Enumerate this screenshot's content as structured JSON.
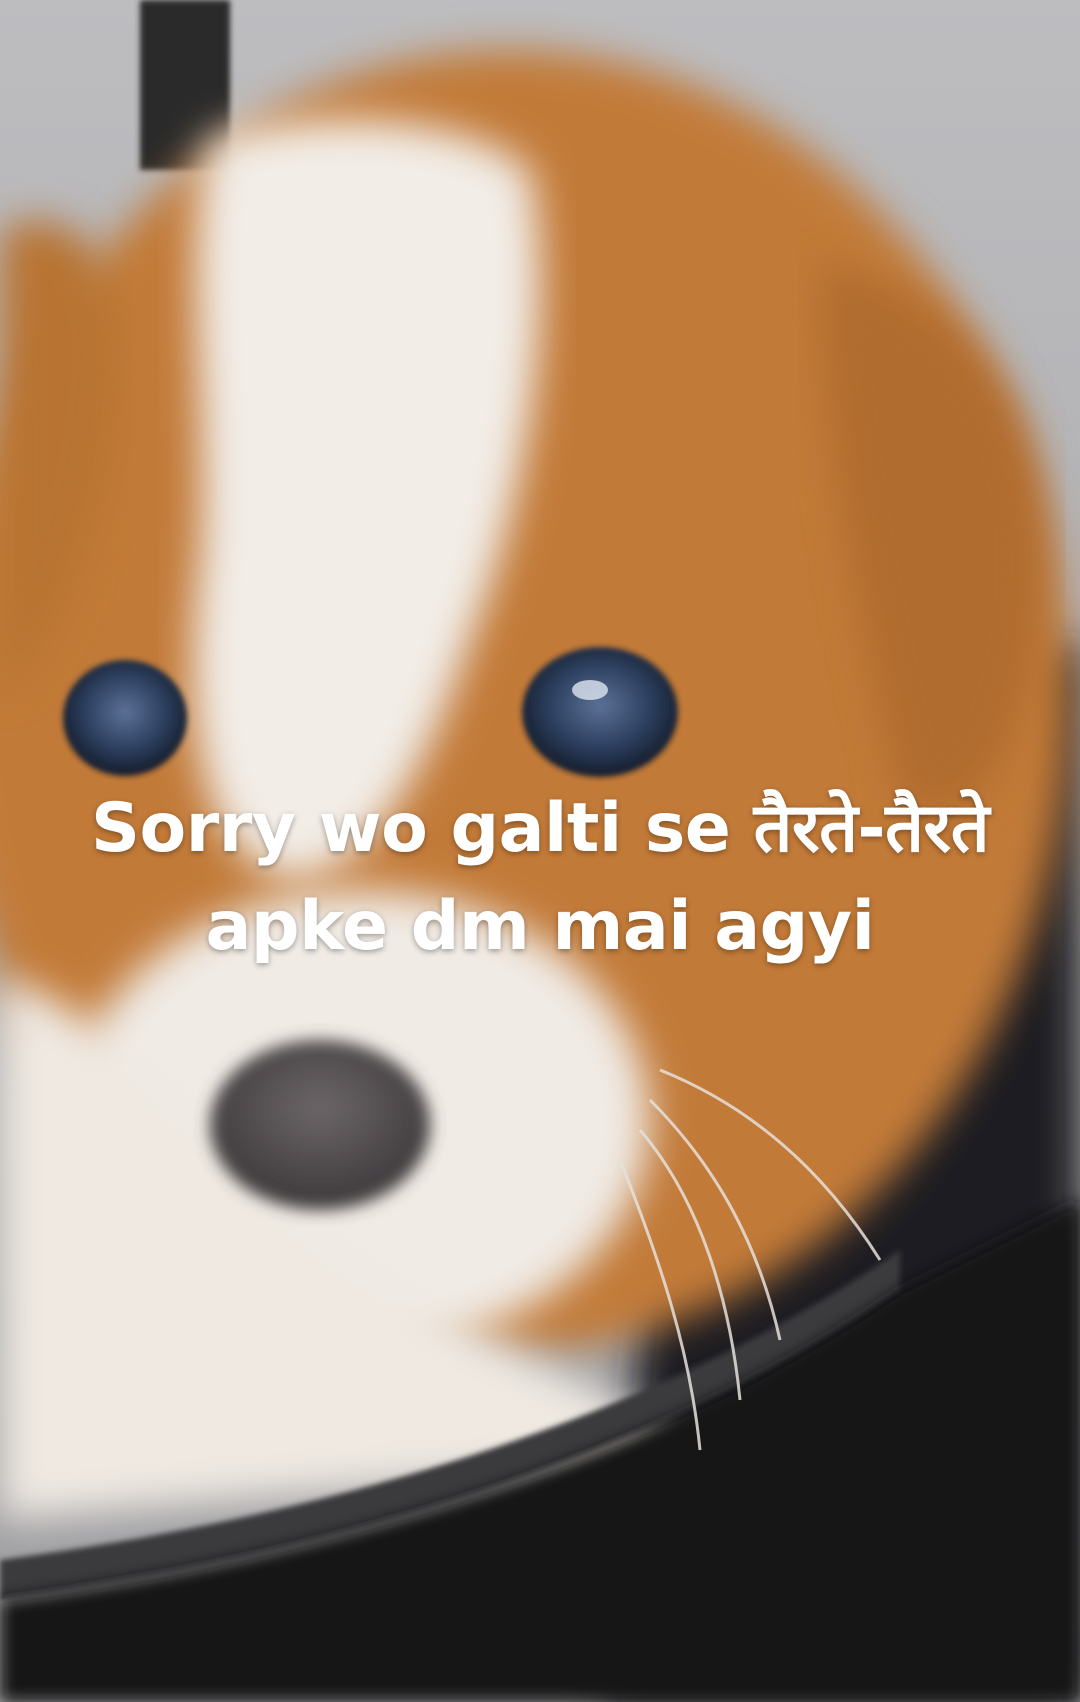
{
  "story": {
    "caption": {
      "line1": "Sorry wo galti se तैरते-तैरते",
      "line2": "apke dm mai agyi"
    },
    "photo": {
      "subject": "puppy-in-metal-bowl",
      "colors": {
        "fur_orange": "#c9813d",
        "fur_white": "#f1ece6",
        "background_gray": "#b1b1b3",
        "bowl_dark": "#1e1e20",
        "eye_blue": "#3f5577",
        "nose": "#5b5658"
      }
    }
  }
}
